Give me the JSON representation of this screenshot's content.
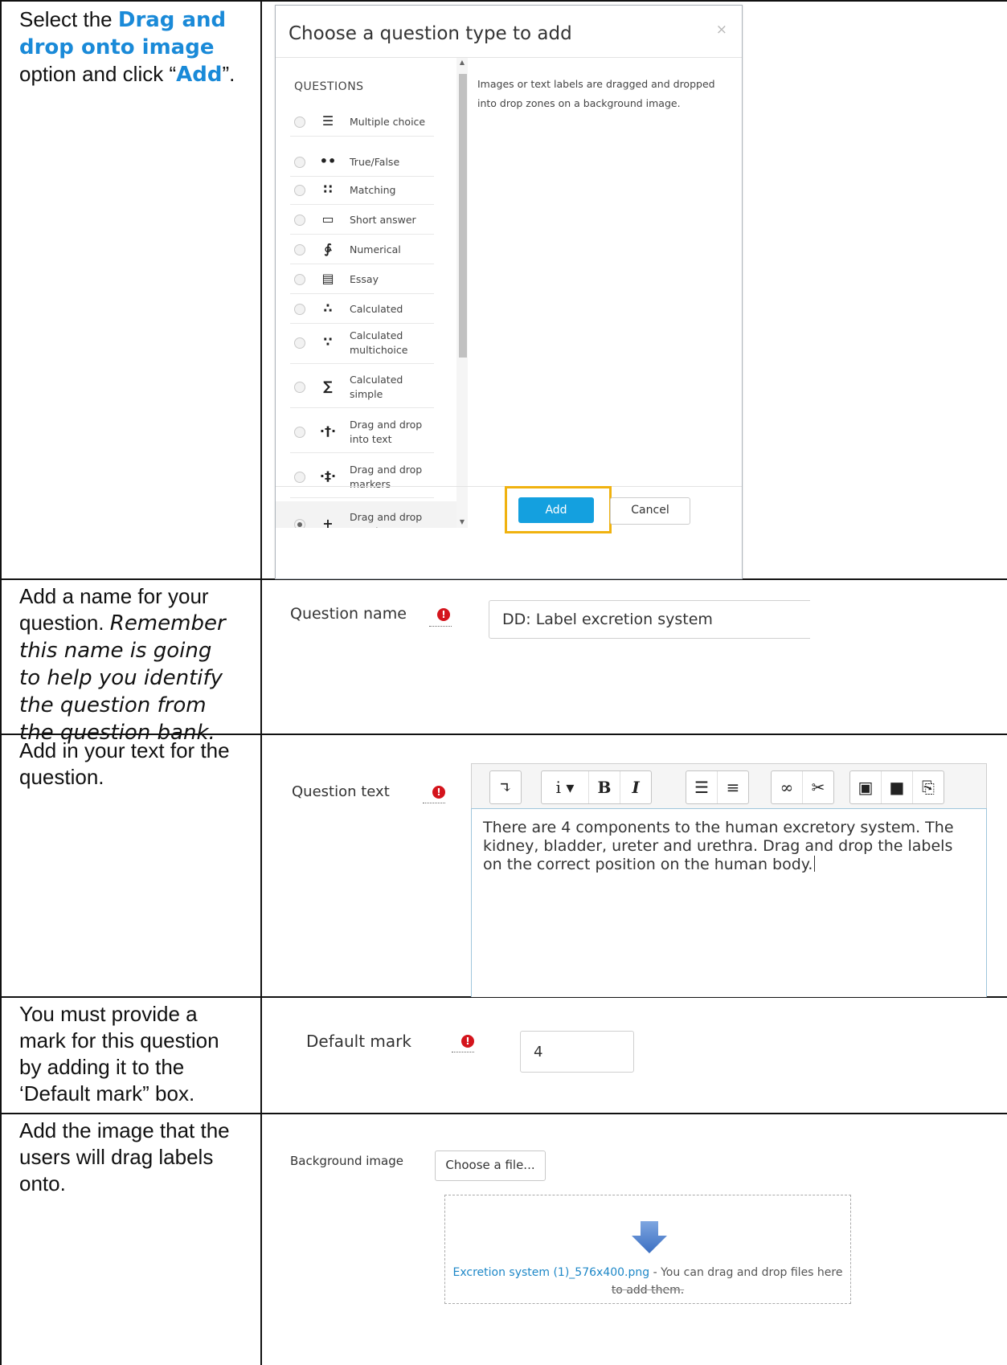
{
  "instructions": {
    "row1": {
      "pre": "Select the ",
      "hl1": "Drag and drop onto image",
      "mid": " option and click “",
      "hl2": "Add",
      "post": "”."
    },
    "row2": {
      "plain": "Add a name for your question. ",
      "italic": "Remember this name is going to help you identify the question from the question bank."
    },
    "row3": {
      "text": "Add in your text for the question."
    },
    "row4": {
      "text": "You must provide a mark for this question by adding it to the ‘Default mark” box."
    },
    "row5": {
      "text": "Add the image that the users will drag labels onto."
    }
  },
  "dialog": {
    "title": "Choose a question type to add",
    "close": "×",
    "list_label": "QUESTIONS",
    "description": "Images or text labels are dragged and dropped into drop zones on a background image.",
    "items": [
      {
        "icon": "☰",
        "label": "Multiple choice"
      },
      {
        "icon": "••",
        "label": "True/False"
      },
      {
        "icon": "∷",
        "label": "Matching"
      },
      {
        "icon": "▭",
        "label": "Short answer"
      },
      {
        "icon": "∳",
        "label": "Numerical"
      },
      {
        "icon": "▤",
        "label": "Essay"
      },
      {
        "icon": "∴",
        "label": "Calculated"
      },
      {
        "icon": "∵",
        "label": "Calculated multichoice"
      },
      {
        "icon": "∑",
        "label": "Calculated simple"
      },
      {
        "icon": "·†·",
        "label": "Drag and drop into text"
      },
      {
        "icon": "·‡·",
        "label": "Drag and drop markers"
      },
      {
        "icon": "+",
        "label": "Drag and drop onto image"
      }
    ],
    "add_label": "Add",
    "cancel_label": "Cancel"
  },
  "question_name": {
    "label": "Question name",
    "value": "DD: Label excretion system"
  },
  "question_text": {
    "label": "Question text",
    "value": "There are 4 components to the human excretory system. The kidney, bladder, ureter and urethra. Drag and drop the labels on the correct position on the human body.",
    "toolbar": [
      "↴",
      "i ▾",
      "B",
      "I",
      "☰",
      "≡",
      "∞",
      "✂",
      "▣",
      "■",
      "⎘"
    ]
  },
  "default_mark": {
    "label": "Default mark",
    "value": "4"
  },
  "background_image": {
    "label": "Background image",
    "choose_label": "Choose a file...",
    "file_link": "Excretion system (1)_576x400.png",
    "hint": " - You can drag and drop files here",
    "hint2": "to add them."
  },
  "colors": {
    "accent": "#14a0df",
    "highlight": "#f0b20f",
    "required": "#d4141c",
    "link": "#1d87c7"
  }
}
